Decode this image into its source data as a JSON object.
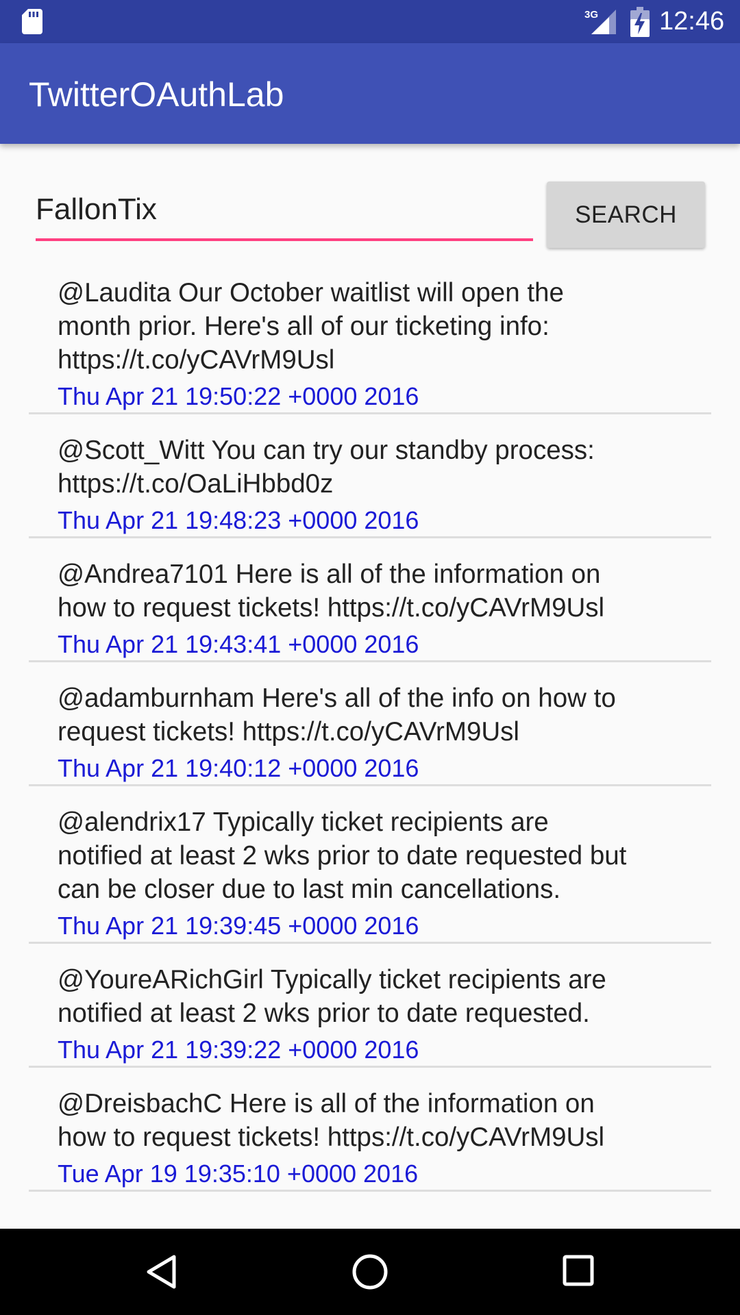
{
  "status_bar": {
    "time": "12:46",
    "network": "3G",
    "icons": [
      "sd-card-icon",
      "cellular-signal-icon",
      "battery-charging-icon"
    ]
  },
  "app_bar": {
    "title": "TwitterOAuthLab"
  },
  "search": {
    "query": "FallonTix",
    "button_label": "SEARCH"
  },
  "colors": {
    "status_bar": "#2f3f9e",
    "app_bar": "#3f51b5",
    "accent": "#ff4081",
    "date_text": "#1a1ad6",
    "background": "#fafafa"
  },
  "tweets": [
    {
      "lines": [
        "@Laudita Our October waitlist will open the",
        "month prior. Here's all of our ticketing info:",
        "https://t.co/yCAVrM9Usl"
      ],
      "date": "Thu Apr 21 19:50:22 +0000 2016"
    },
    {
      "lines": [
        "@Scott_Witt You can try our standby process:",
        "https://t.co/OaLiHbbd0z"
      ],
      "date": "Thu Apr 21 19:48:23 +0000 2016"
    },
    {
      "lines": [
        "@Andrea7101 Here is all of the information on",
        "how to request tickets! https://t.co/yCAVrM9Usl"
      ],
      "date": "Thu Apr 21 19:43:41 +0000 2016"
    },
    {
      "lines": [
        "@adamburnham Here's all of the info on how to",
        "request tickets! https://t.co/yCAVrM9Usl"
      ],
      "date": "Thu Apr 21 19:40:12 +0000 2016"
    },
    {
      "lines": [
        "@alendrix17 Typically ticket recipients are",
        "notified at least 2 wks prior to date requested but",
        "can be closer due to last min cancellations."
      ],
      "date": "Thu Apr 21 19:39:45 +0000 2016"
    },
    {
      "lines": [
        "@YoureARichGirl Typically ticket recipients are",
        "notified at least 2 wks prior to date requested."
      ],
      "date": "Thu Apr 21 19:39:22 +0000 2016"
    },
    {
      "lines": [
        "@DreisbachC Here is all of the information on",
        "how to request tickets! https://t.co/yCAVrM9Usl"
      ],
      "date": "Tue Apr 19 19:35:10 +0000 2016"
    }
  ],
  "nav_bar": {
    "icons": [
      "back-icon",
      "home-icon",
      "recents-icon"
    ]
  }
}
